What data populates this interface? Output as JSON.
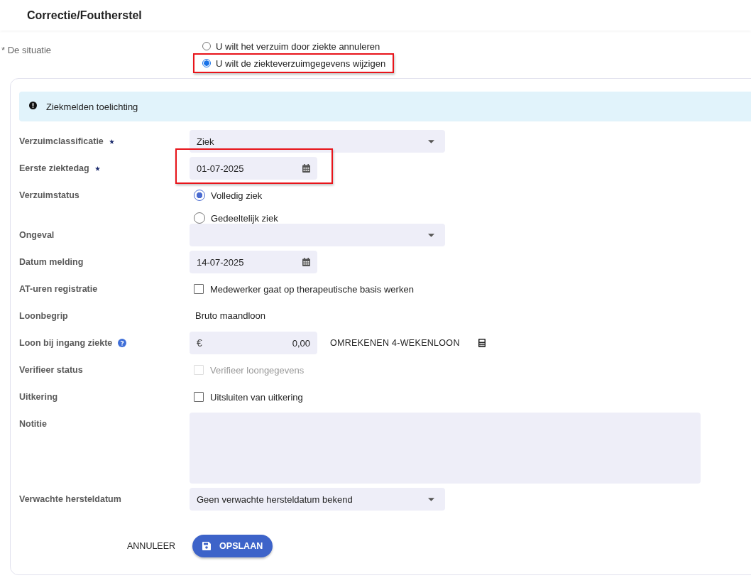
{
  "header": {
    "title": "Correctie/Foutherstel"
  },
  "situation": {
    "label": "* De situatie",
    "options": [
      {
        "label": "U wilt het verzuim door ziekte annuleren",
        "selected": false,
        "highlighted": false
      },
      {
        "label": "U wilt de ziekteverzuimgegevens wijzigen",
        "selected": true,
        "highlighted": true
      }
    ]
  },
  "info": {
    "text": "Ziekmelden toelichting"
  },
  "rows": [
    {
      "kind": "select",
      "label": "Verzuimclassificatie",
      "required": true,
      "value": "Ziek"
    },
    {
      "kind": "date",
      "label": "Eerste ziektedag",
      "required": true,
      "value": "01-07-2025",
      "highlighted": true
    },
    {
      "kind": "radio",
      "label": "Verzuimstatus",
      "options": [
        {
          "label": "Volledig ziek",
          "selected": true
        },
        {
          "label": "Gedeeltelijk ziek",
          "selected": false
        }
      ]
    },
    {
      "kind": "select",
      "label": "Ongeval",
      "value": ""
    },
    {
      "kind": "date",
      "label": "Datum melding",
      "value": "14-07-2025",
      "highlighted": false
    },
    {
      "kind": "checkbox",
      "label": "AT-uren registratie",
      "text": "Medewerker gaat op therapeutische basis werken",
      "checked": false,
      "disabled": false
    },
    {
      "kind": "text",
      "label": "Loonbegrip",
      "value": "Bruto maandloon"
    },
    {
      "kind": "money",
      "label": "Loon bij ingang ziekte",
      "help": true,
      "currency": "€",
      "value": "0,00",
      "action": "OMREKENEN 4-WEKENLOON"
    },
    {
      "kind": "checkbox",
      "label": "Verifieer status",
      "text": "Verifieer loongegevens",
      "checked": false,
      "disabled": true
    },
    {
      "kind": "checkbox",
      "label": "Uitkering",
      "text": "Uitsluiten van uitkering",
      "checked": false,
      "disabled": false
    },
    {
      "kind": "textarea",
      "label": "Notitie",
      "value": ""
    },
    {
      "kind": "select",
      "label": "Verwachte hersteldatum",
      "value": "Geen verwachte hersteldatum bekend"
    }
  ],
  "buttons": {
    "cancel": "ANNULEER",
    "save": "OPSLAAN"
  }
}
